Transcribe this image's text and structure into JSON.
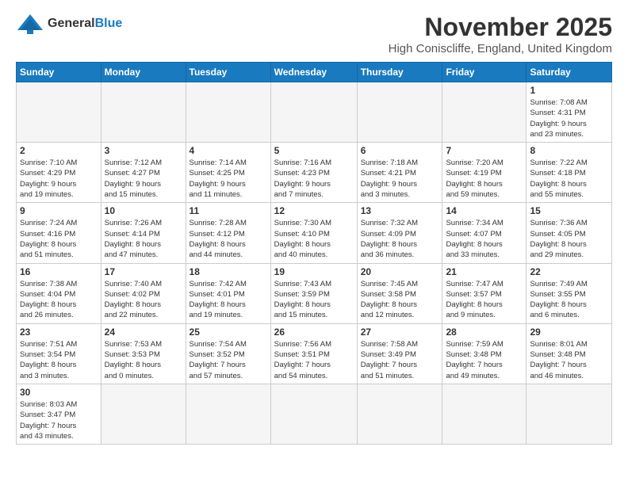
{
  "logo": {
    "text_general": "General",
    "text_blue": "Blue"
  },
  "header": {
    "title": "November 2025",
    "location": "High Coniscliffe, England, United Kingdom"
  },
  "weekdays": [
    "Sunday",
    "Monday",
    "Tuesday",
    "Wednesday",
    "Thursday",
    "Friday",
    "Saturday"
  ],
  "weeks": [
    [
      {
        "day": "",
        "info": ""
      },
      {
        "day": "",
        "info": ""
      },
      {
        "day": "",
        "info": ""
      },
      {
        "day": "",
        "info": ""
      },
      {
        "day": "",
        "info": ""
      },
      {
        "day": "",
        "info": ""
      },
      {
        "day": "1",
        "info": "Sunrise: 7:08 AM\nSunset: 4:31 PM\nDaylight: 9 hours\nand 23 minutes."
      }
    ],
    [
      {
        "day": "2",
        "info": "Sunrise: 7:10 AM\nSunset: 4:29 PM\nDaylight: 9 hours\nand 19 minutes."
      },
      {
        "day": "3",
        "info": "Sunrise: 7:12 AM\nSunset: 4:27 PM\nDaylight: 9 hours\nand 15 minutes."
      },
      {
        "day": "4",
        "info": "Sunrise: 7:14 AM\nSunset: 4:25 PM\nDaylight: 9 hours\nand 11 minutes."
      },
      {
        "day": "5",
        "info": "Sunrise: 7:16 AM\nSunset: 4:23 PM\nDaylight: 9 hours\nand 7 minutes."
      },
      {
        "day": "6",
        "info": "Sunrise: 7:18 AM\nSunset: 4:21 PM\nDaylight: 9 hours\nand 3 minutes."
      },
      {
        "day": "7",
        "info": "Sunrise: 7:20 AM\nSunset: 4:19 PM\nDaylight: 8 hours\nand 59 minutes."
      },
      {
        "day": "8",
        "info": "Sunrise: 7:22 AM\nSunset: 4:18 PM\nDaylight: 8 hours\nand 55 minutes."
      }
    ],
    [
      {
        "day": "9",
        "info": "Sunrise: 7:24 AM\nSunset: 4:16 PM\nDaylight: 8 hours\nand 51 minutes."
      },
      {
        "day": "10",
        "info": "Sunrise: 7:26 AM\nSunset: 4:14 PM\nDaylight: 8 hours\nand 47 minutes."
      },
      {
        "day": "11",
        "info": "Sunrise: 7:28 AM\nSunset: 4:12 PM\nDaylight: 8 hours\nand 44 minutes."
      },
      {
        "day": "12",
        "info": "Sunrise: 7:30 AM\nSunset: 4:10 PM\nDaylight: 8 hours\nand 40 minutes."
      },
      {
        "day": "13",
        "info": "Sunrise: 7:32 AM\nSunset: 4:09 PM\nDaylight: 8 hours\nand 36 minutes."
      },
      {
        "day": "14",
        "info": "Sunrise: 7:34 AM\nSunset: 4:07 PM\nDaylight: 8 hours\nand 33 minutes."
      },
      {
        "day": "15",
        "info": "Sunrise: 7:36 AM\nSunset: 4:05 PM\nDaylight: 8 hours\nand 29 minutes."
      }
    ],
    [
      {
        "day": "16",
        "info": "Sunrise: 7:38 AM\nSunset: 4:04 PM\nDaylight: 8 hours\nand 26 minutes."
      },
      {
        "day": "17",
        "info": "Sunrise: 7:40 AM\nSunset: 4:02 PM\nDaylight: 8 hours\nand 22 minutes."
      },
      {
        "day": "18",
        "info": "Sunrise: 7:42 AM\nSunset: 4:01 PM\nDaylight: 8 hours\nand 19 minutes."
      },
      {
        "day": "19",
        "info": "Sunrise: 7:43 AM\nSunset: 3:59 PM\nDaylight: 8 hours\nand 15 minutes."
      },
      {
        "day": "20",
        "info": "Sunrise: 7:45 AM\nSunset: 3:58 PM\nDaylight: 8 hours\nand 12 minutes."
      },
      {
        "day": "21",
        "info": "Sunrise: 7:47 AM\nSunset: 3:57 PM\nDaylight: 8 hours\nand 9 minutes."
      },
      {
        "day": "22",
        "info": "Sunrise: 7:49 AM\nSunset: 3:55 PM\nDaylight: 8 hours\nand 6 minutes."
      }
    ],
    [
      {
        "day": "23",
        "info": "Sunrise: 7:51 AM\nSunset: 3:54 PM\nDaylight: 8 hours\nand 3 minutes."
      },
      {
        "day": "24",
        "info": "Sunrise: 7:53 AM\nSunset: 3:53 PM\nDaylight: 8 hours\nand 0 minutes."
      },
      {
        "day": "25",
        "info": "Sunrise: 7:54 AM\nSunset: 3:52 PM\nDaylight: 7 hours\nand 57 minutes."
      },
      {
        "day": "26",
        "info": "Sunrise: 7:56 AM\nSunset: 3:51 PM\nDaylight: 7 hours\nand 54 minutes."
      },
      {
        "day": "27",
        "info": "Sunrise: 7:58 AM\nSunset: 3:49 PM\nDaylight: 7 hours\nand 51 minutes."
      },
      {
        "day": "28",
        "info": "Sunrise: 7:59 AM\nSunset: 3:48 PM\nDaylight: 7 hours\nand 49 minutes."
      },
      {
        "day": "29",
        "info": "Sunrise: 8:01 AM\nSunset: 3:48 PM\nDaylight: 7 hours\nand 46 minutes."
      }
    ],
    [
      {
        "day": "30",
        "info": "Sunrise: 8:03 AM\nSunset: 3:47 PM\nDaylight: 7 hours\nand 43 minutes."
      },
      {
        "day": "",
        "info": ""
      },
      {
        "day": "",
        "info": ""
      },
      {
        "day": "",
        "info": ""
      },
      {
        "day": "",
        "info": ""
      },
      {
        "day": "",
        "info": ""
      },
      {
        "day": "",
        "info": ""
      }
    ]
  ]
}
